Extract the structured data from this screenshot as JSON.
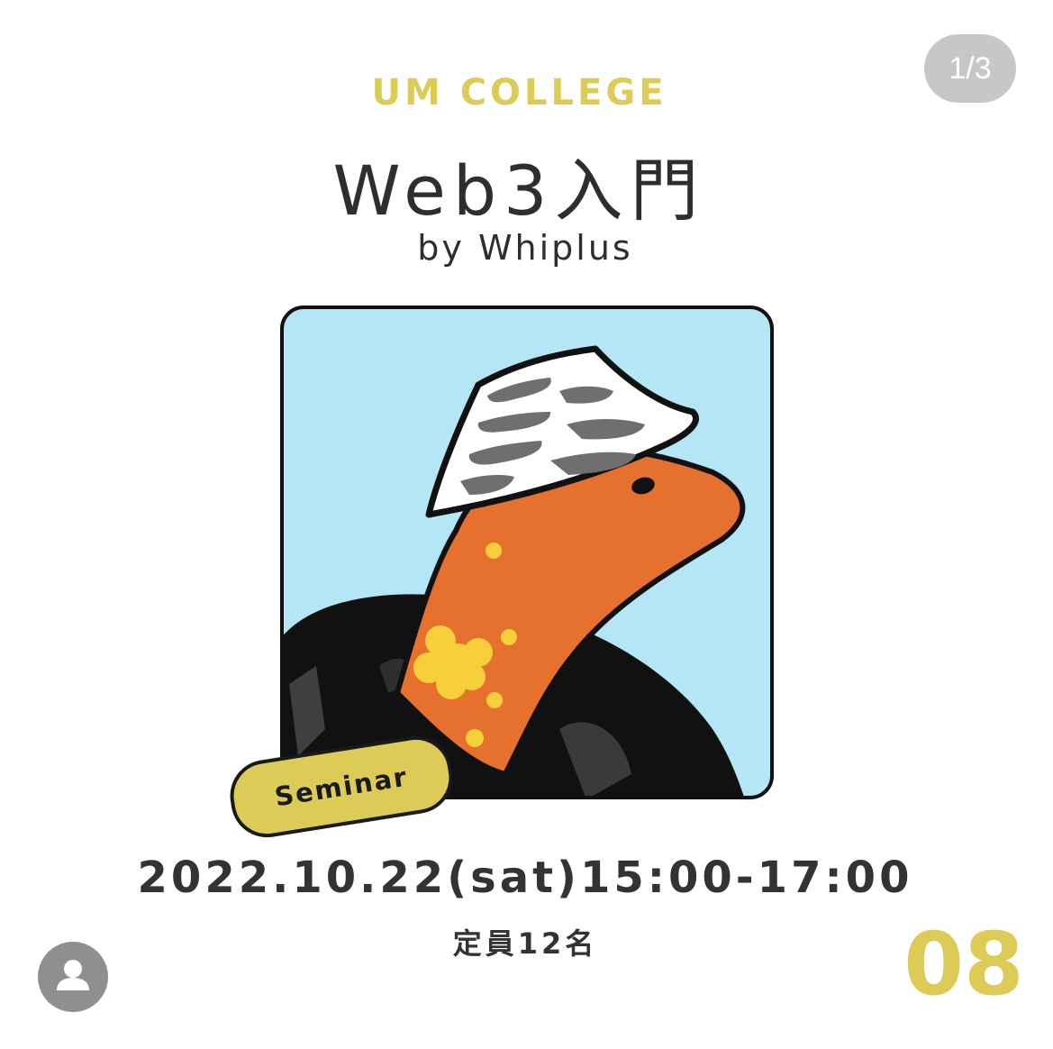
{
  "carousel": {
    "counter": "1/3"
  },
  "card": {
    "brand": "UM COLLEGE",
    "title": "Web3入門",
    "byline": "by Whiplus",
    "badge": "Seminar",
    "datetime": "2022.10.22(sat)15:00-17:00",
    "capacity": "定員12名",
    "issue_number": "08",
    "colors": {
      "accent": "#dccb57",
      "text": "#2e2e2e",
      "art_background": "#b5e6f6",
      "character_orange": "#e6702e"
    }
  },
  "icons": {
    "artwork": "orange-creature-with-bucket-hat-illustration",
    "avatar": "user-icon"
  }
}
